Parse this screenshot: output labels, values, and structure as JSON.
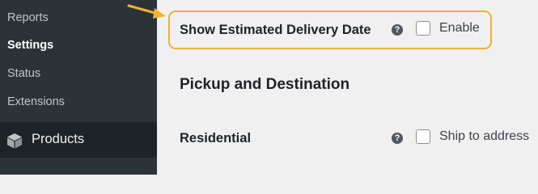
{
  "sidebar": {
    "submenu": [
      {
        "label": "Reports",
        "current": false
      },
      {
        "label": "Settings",
        "current": true
      },
      {
        "label": "Status",
        "current": false
      },
      {
        "label": "Extensions",
        "current": false
      }
    ],
    "products": {
      "label": "Products",
      "icon": "box-icon"
    }
  },
  "settings": {
    "estimated_delivery": {
      "label": "Show Estimated Delivery Date",
      "checkbox_label": "Enable",
      "checked": false
    },
    "section_title": "Pickup and Destination",
    "residential": {
      "label": "Residential",
      "checkbox_label": "Ship to address",
      "checked": false
    },
    "help_glyph": "?"
  },
  "annotation": {
    "highlight_color": "#f0b232",
    "arrow_color": "#f0b232"
  },
  "colors": {
    "sidebar_bg": "#2c3338",
    "menu_active_bg": "#1d2327",
    "content_bg": "#f0f0f1",
    "text_dark": "#1d2327"
  }
}
